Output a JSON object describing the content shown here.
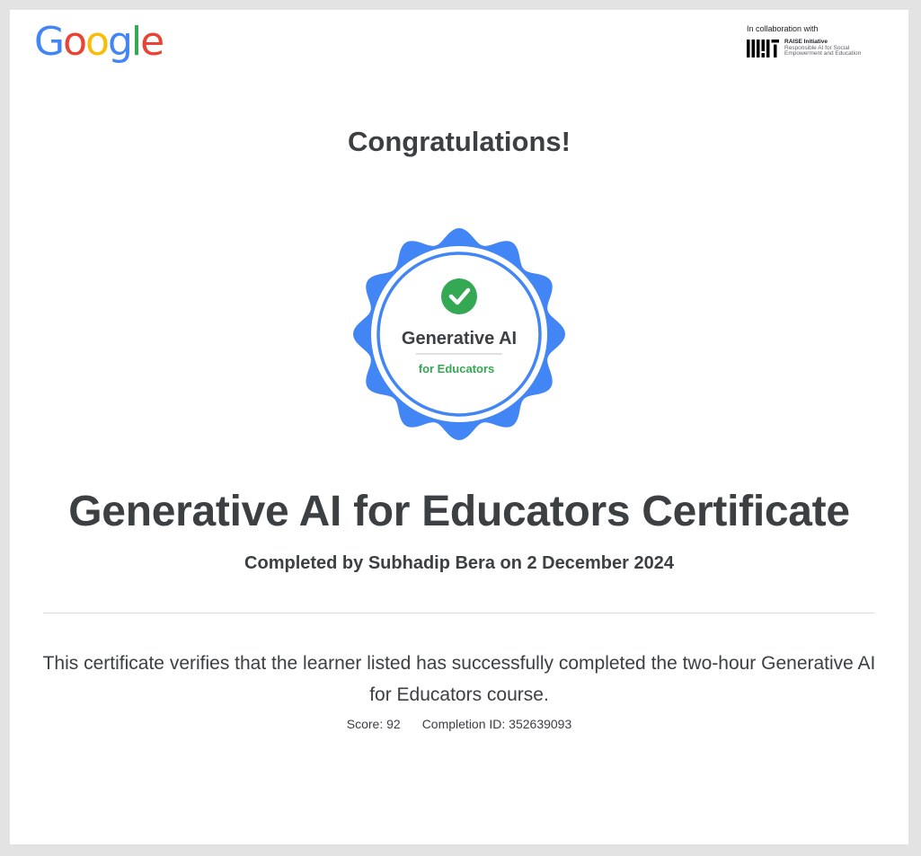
{
  "header": {
    "logo": {
      "letters": [
        "G",
        "o",
        "o",
        "g",
        "l",
        "e"
      ],
      "colors": [
        "#4285F4",
        "#EA4335",
        "#FBBC05",
        "#4285F4",
        "#34A853",
        "#EA4335"
      ]
    },
    "collaboration": {
      "label": "In collaboration with",
      "org_logo_text": "MIT",
      "partner_title": "RAISE Initiative",
      "partner_line1": "Responsible AI for Social",
      "partner_line2": "Empowerment and Education"
    }
  },
  "certificate": {
    "greeting": "Congratulations!",
    "badge": {
      "title": "Generative AI",
      "subtitle": "for Educators",
      "icon": "check-circle-icon",
      "accent_color": "#4285F4",
      "check_color": "#34A853"
    },
    "title": "Generative AI for Educators Certificate",
    "completed_line": "Completed by Subhadip Bera on 2 December 2024",
    "description": "This certificate verifies that the learner listed has successfully completed the two-hour Generative AI for Educators course.",
    "score_text": "Score: 92",
    "completion_id_text": "Completion ID: 352639093"
  }
}
